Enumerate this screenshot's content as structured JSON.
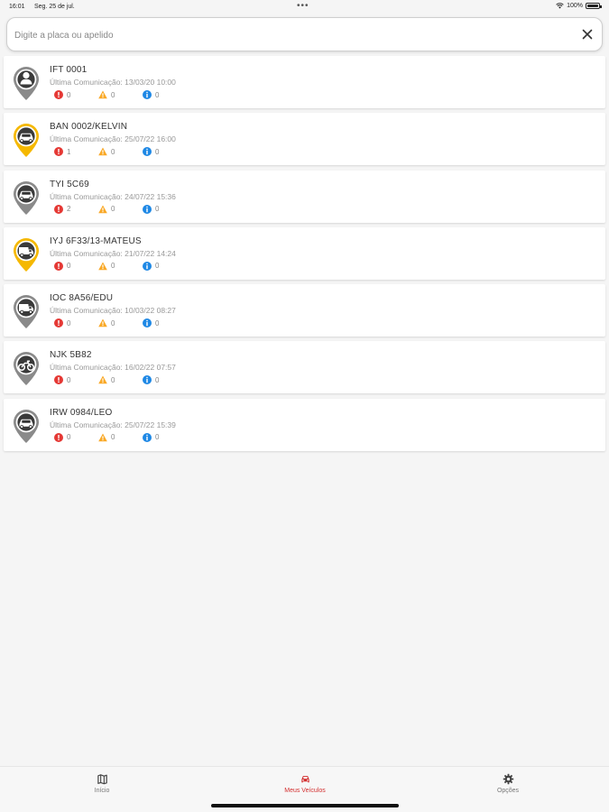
{
  "status_bar": {
    "time": "16:01",
    "date": "Seg. 25 de jul.",
    "dots": "•••",
    "battery": "100%",
    "wifi_icon": "wifi-icon",
    "battery_icon": "battery-icon"
  },
  "search": {
    "placeholder": "Digite a placa ou apelido",
    "value": "",
    "clear_icon": "close-icon"
  },
  "colors": {
    "error": "#e53935",
    "warning": "#f9a825",
    "info": "#1e88e5",
    "pin_gray": "#8a8a8a",
    "pin_yellow": "#f5b800",
    "active_tab": "#d32f2f"
  },
  "vehicles": [
    {
      "plate": "IFT 0001",
      "last_comm": "Última Comunicação: 13/03/20 10:00",
      "pin_color": "gray",
      "icon": "person-icon",
      "errors": "0",
      "warnings": "0",
      "infos": "0"
    },
    {
      "plate": "BAN 0002/KELVIN",
      "last_comm": "Última Comunicação: 25/07/22 16:00",
      "pin_color": "yellow",
      "icon": "car-icon",
      "errors": "1",
      "warnings": "0",
      "infos": "0"
    },
    {
      "plate": "TYI 5C69",
      "last_comm": "Última Comunicação: 24/07/22 15:36",
      "pin_color": "gray",
      "icon": "car-icon",
      "errors": "2",
      "warnings": "0",
      "infos": "0"
    },
    {
      "plate": "IYJ 6F33/13-MATEUS",
      "last_comm": "Última Comunicação: 21/07/22 14:24",
      "pin_color": "yellow",
      "icon": "truck-icon",
      "errors": "0",
      "warnings": "0",
      "infos": "0"
    },
    {
      "plate": "IOC 8A56/EDU",
      "last_comm": "Última Comunicação: 10/03/22 08:27",
      "pin_color": "gray",
      "icon": "truck-icon",
      "errors": "0",
      "warnings": "0",
      "infos": "0"
    },
    {
      "plate": "NJK 5B82",
      "last_comm": "Última Comunicação: 16/02/22 07:57",
      "pin_color": "gray",
      "icon": "motorcycle-icon",
      "errors": "0",
      "warnings": "0",
      "infos": "0"
    },
    {
      "plate": "IRW 0984/LEO",
      "last_comm": "Última Comunicação: 25/07/22 15:39",
      "pin_color": "gray",
      "icon": "car-icon",
      "errors": "0",
      "warnings": "0",
      "infos": "0"
    }
  ],
  "tabs": [
    {
      "label": "Início",
      "icon": "map-icon",
      "active": false
    },
    {
      "label": "Meus Veículos",
      "icon": "car-icon",
      "active": true
    },
    {
      "label": "Opções",
      "icon": "gear-icon",
      "active": false
    }
  ]
}
